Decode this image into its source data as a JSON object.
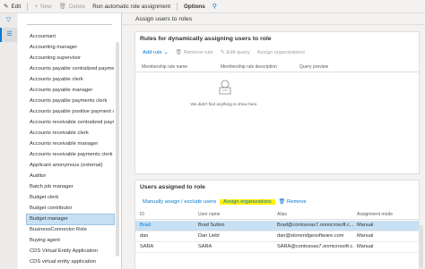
{
  "toolbar": {
    "edit": "Edit",
    "new": "New",
    "delete": "Delete",
    "run": "Run automatic role assignment",
    "options": "Options"
  },
  "roles": {
    "items": [
      "Accountant",
      "Accounting manager",
      "Accounting supervisor",
      "Accounts payable centralized payments",
      "Accounts payable clerk",
      "Accounts payable manager",
      "Accounts payable payments clerk",
      "Accounts payable positive payment clerk",
      "Accounts receivable centralized paymen",
      "Accounts receivable clerk",
      "Accounts receivable manager",
      "Accounts receivable payments clerk",
      "Applicant anonymous (external)",
      "Auditor",
      "Batch job manager",
      "Budget clerk",
      "Budget contributor",
      "Budget manager",
      "BusinessConnector Role",
      "Buying agent",
      "CDS Virtual Entity Application",
      "CDS virtual entity application"
    ],
    "selected": "Budget manager"
  },
  "page": {
    "title": "Assign users to roles"
  },
  "rules": {
    "title": "Rules for dynamically assigning users to role",
    "add_rule": "Add rule",
    "remove_rule": "Remove rule",
    "edit_query": "Edit query",
    "assign_orgs": "Assign organizations",
    "columns": [
      "Membership rule name",
      "Membership rule description",
      "Query preview"
    ],
    "empty_text": "We didn't find anything to show here."
  },
  "users": {
    "title": "Users assigned to role",
    "manual_assign": "Manually assign / exclude users",
    "assign_orgs": "Assign organizations",
    "remove": "Remove",
    "columns": [
      "ID",
      "User name",
      "Alias",
      "Assignment mode"
    ],
    "rows": [
      {
        "id": "Brad",
        "name": "Brad Sutton",
        "alias": "Brad@contosoax7.onmicrosoft.c...",
        "mode": "Manual"
      },
      {
        "id": "dan",
        "name": "Dan Liebl",
        "alias": "dan@stoneridgesoftware.com",
        "mode": "Manual"
      },
      {
        "id": "SARA",
        "name": "SARA",
        "alias": "SARA@contosoax7.onmicrosoft.c...",
        "mode": "Manual"
      }
    ]
  },
  "colors": {
    "accent": "#0078d4",
    "highlight": "#fff100",
    "selected": "#c7e0f4"
  }
}
